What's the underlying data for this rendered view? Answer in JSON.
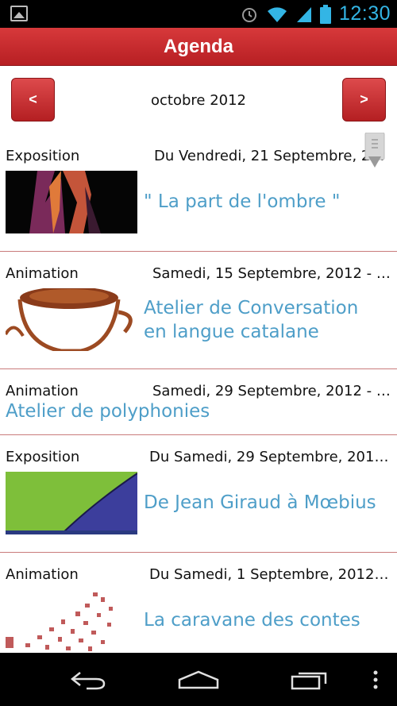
{
  "status": {
    "time": "12:30"
  },
  "header": {
    "title": "Agenda"
  },
  "month_nav": {
    "prev_label": "<",
    "next_label": ">",
    "month": "octobre 2012"
  },
  "events": [
    {
      "category": "Exposition",
      "date": "Du Vendredi, 21 Septembre, 2012 ...",
      "title": "\" La part de l'ombre \""
    },
    {
      "category": "Animation",
      "date": "Samedi, 15 Septembre, 2012 - 1...",
      "title": "Atelier de Conversation en langue catalane"
    },
    {
      "category": "Animation",
      "date": "Samedi, 29 Septembre, 2012 - 1...",
      "title": "Atelier de polyphonies"
    },
    {
      "category": "Exposition",
      "date": "Du Samedi, 29 Septembre, 2012 ...",
      "title": "De Jean Giraud à Mœbius"
    },
    {
      "category": "Animation",
      "date": "Du Samedi, 1 Septembre, 2012 a...",
      "title": "La caravane des contes"
    }
  ],
  "colors": {
    "accent": "#c62a2d",
    "title_link": "#4e9ec8",
    "status_blue": "#33b5e5"
  }
}
